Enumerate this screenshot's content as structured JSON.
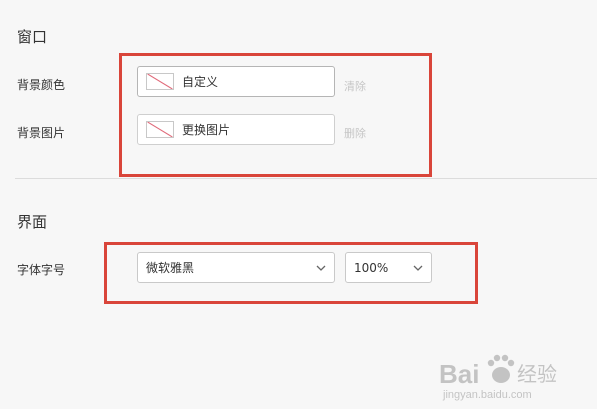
{
  "window_section": {
    "title": "窗口",
    "bg_color": {
      "label": "背景颜色",
      "value": "自定义",
      "action": "清除"
    },
    "bg_image": {
      "label": "背景图片",
      "value": "更换图片",
      "action": "删除"
    }
  },
  "interface_section": {
    "title": "界面",
    "font": {
      "label": "字体字号",
      "family_value": "微软雅黑",
      "size_value": "100%"
    }
  },
  "colors": {
    "highlight": "#d9453a",
    "swatch_slash": "#e06a7a"
  },
  "watermark": {
    "brand": "Bai",
    "brand_tail": "经验",
    "url": "jingyan.baidu.com"
  }
}
